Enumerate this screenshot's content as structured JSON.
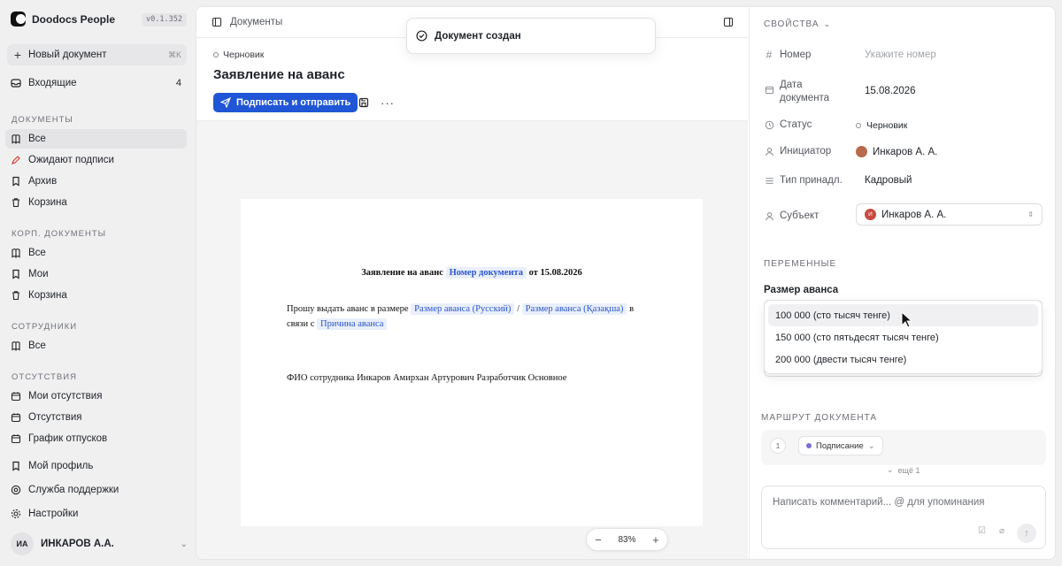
{
  "app": {
    "name": "Doodocs People",
    "version": "v0.1.352"
  },
  "sidebar": {
    "new_doc": {
      "label": "Новый документ",
      "shortcut": "⌘K"
    },
    "inbox": {
      "label": "Входящие",
      "count": "4"
    },
    "sections": [
      {
        "title": "Документы",
        "items": [
          "Все",
          "Ожидают подписи",
          "Архив",
          "Корзина"
        ]
      },
      {
        "title": "Корп. документы",
        "items": [
          "Все",
          "Мои",
          "Корзина"
        ]
      },
      {
        "title": "Сотрудники",
        "items": [
          "Все"
        ]
      },
      {
        "title": "Отсутствия",
        "items": [
          "Мои отсутствия",
          "Отсутствия",
          "График отпусков"
        ]
      }
    ],
    "footer_items": [
      "Мой профиль",
      "Служба поддержки",
      "Настройки"
    ],
    "user": {
      "initials": "ИА",
      "name": "ИНКАРОВ А.А."
    }
  },
  "topbar": {
    "breadcrumb": "Документы"
  },
  "document": {
    "status": "Черновик",
    "title": "Заявление на аванс",
    "sign_button": "Подписать и отправить",
    "paper": {
      "title_prefix": "Заявление на аванс",
      "title_var": "Номер документа",
      "title_suffix": "от 15.08.2026",
      "para_start": "Прошу выдать аванс в размере",
      "var_ru": "Размер аванса (Русский)",
      "slash": "/",
      "var_kz": "Размер аванса (Қазақша)",
      "para_mid": "в связи с",
      "var_reason": "Причина аванса",
      "fio": "ФИО сотрудника Инкаров Амирхан Артурович Разработчик Основное"
    },
    "zoom": "83%"
  },
  "toast": {
    "text": "Документ создан"
  },
  "properties": {
    "header": "Свойства",
    "rows": {
      "number": {
        "label": "Номер",
        "placeholder": "Укажите номер"
      },
      "date": {
        "label": "Дата документа",
        "value": "15.08.2026"
      },
      "status": {
        "label": "Статус",
        "value": "Черновик"
      },
      "initiator": {
        "label": "Инициатор",
        "value": "Инкаров А. А."
      },
      "type": {
        "label": "Тип принадл.",
        "value": "Кадровый"
      },
      "subject": {
        "label": "Субъект",
        "value": "Инкаров А. А.",
        "avatar_letter": "И"
      }
    },
    "variables_header": "Переменные",
    "variable": {
      "label": "Размер аванса",
      "options": [
        "100 000 (сто тысяч тенге)",
        "150 000 (сто пятьдесят тысяч тенге)",
        "200 000 (двести тысяч тенге)"
      ]
    },
    "route_header": "Маршрут документа",
    "route": {
      "step": "1",
      "stage": "Подписание",
      "more": "ещё 1"
    },
    "comment_placeholder": "Написать комментарий... @ для упоминания"
  },
  "colors": {
    "accent": "#2056d6",
    "var_chip_bg": "#e9effc",
    "var_chip_text": "#2a55c9"
  }
}
